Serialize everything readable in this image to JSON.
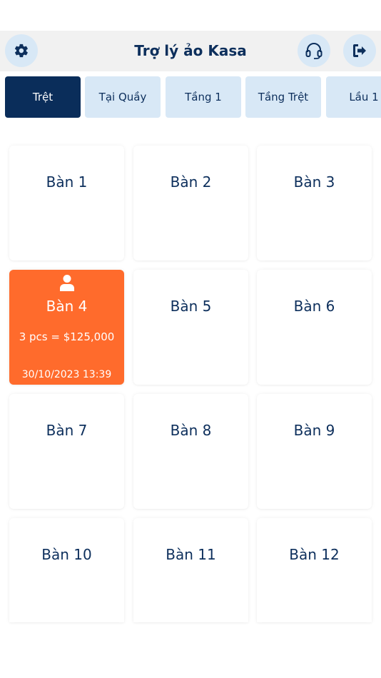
{
  "header": {
    "title": "Trợ lý ảo Kasa",
    "settings_icon": "gear-icon",
    "support_icon": "headset-icon",
    "logout_icon": "logout-icon"
  },
  "tabs": [
    {
      "label": "Trệt",
      "active": true
    },
    {
      "label": "Tại Quầy",
      "active": false
    },
    {
      "label": "Tầng 1",
      "active": false
    },
    {
      "label": "Tầng Trệt",
      "active": false
    },
    {
      "label": "Lầu 1",
      "active": false
    }
  ],
  "tables": [
    {
      "name": "Bàn 1"
    },
    {
      "name": "Bàn 2"
    },
    {
      "name": "Bàn 3"
    },
    {
      "name": "Bàn 4",
      "occupied": true,
      "summary": "3 pcs = $125,000",
      "time": "30/10/2023 13:39"
    },
    {
      "name": "Bàn 5"
    },
    {
      "name": "Bàn 6"
    },
    {
      "name": "Bàn 7"
    },
    {
      "name": "Bàn 8"
    },
    {
      "name": "Bàn 9"
    },
    {
      "name": "Bàn 10"
    },
    {
      "name": "Bàn 11"
    },
    {
      "name": "Bàn 12"
    }
  ],
  "colors": {
    "primary": "#0a2d5a",
    "tab_inactive": "#d8e8f6",
    "occupied": "#ff6b2c"
  }
}
